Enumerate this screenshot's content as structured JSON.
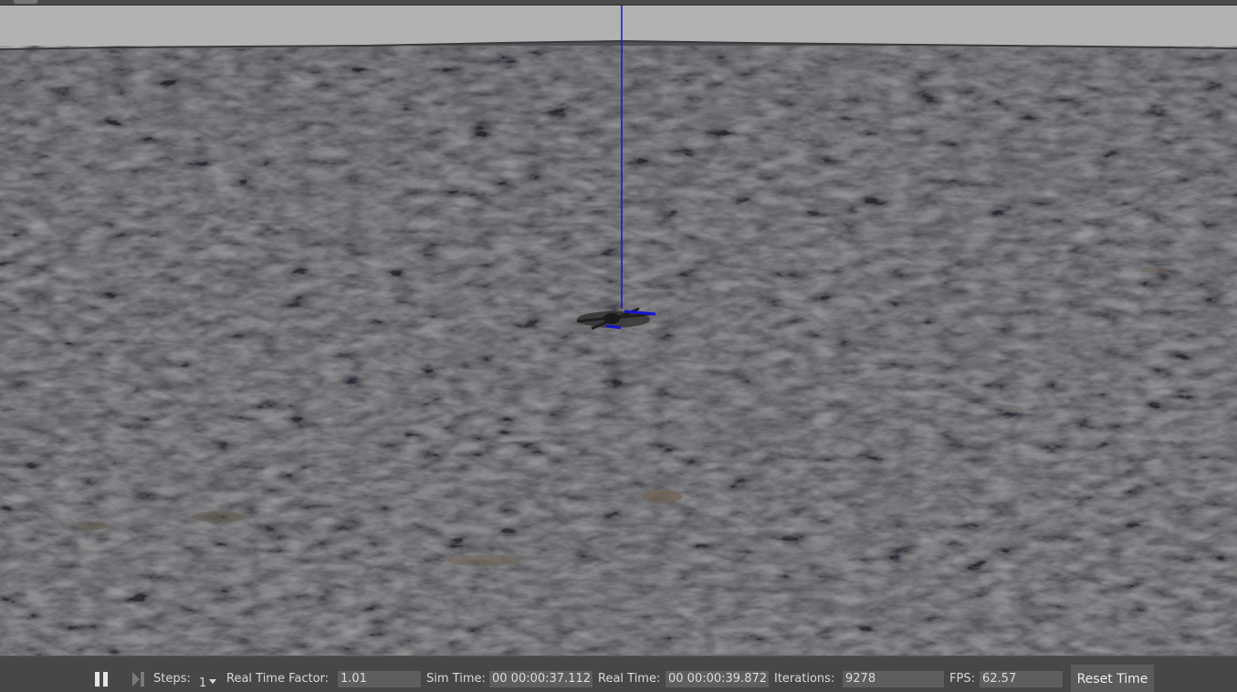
{
  "toolbar": {
    "steps_label": "Steps:",
    "steps_value": "1",
    "rtf_label": "Real Time Factor:",
    "rtf_value": "1.01",
    "sim_time_label": "Sim Time:",
    "sim_time_value": "00 00:00:37.112",
    "real_time_label": "Real Time:",
    "real_time_value": "00 00:00:39.872",
    "iterations_label": "Iterations:",
    "iterations_value": "9278",
    "fps_label": "FPS:",
    "fps_value": "62.57",
    "reset_label": "Reset Time"
  },
  "icons": {
    "pause": "pause-icon",
    "step": "step-forward-icon",
    "dropdown": "chevron-down-icon"
  },
  "colors": {
    "sky": "#b2b2b2",
    "ground": "#55555a",
    "axis_z": "#1414d2",
    "toolbar_bg": "#474747"
  }
}
